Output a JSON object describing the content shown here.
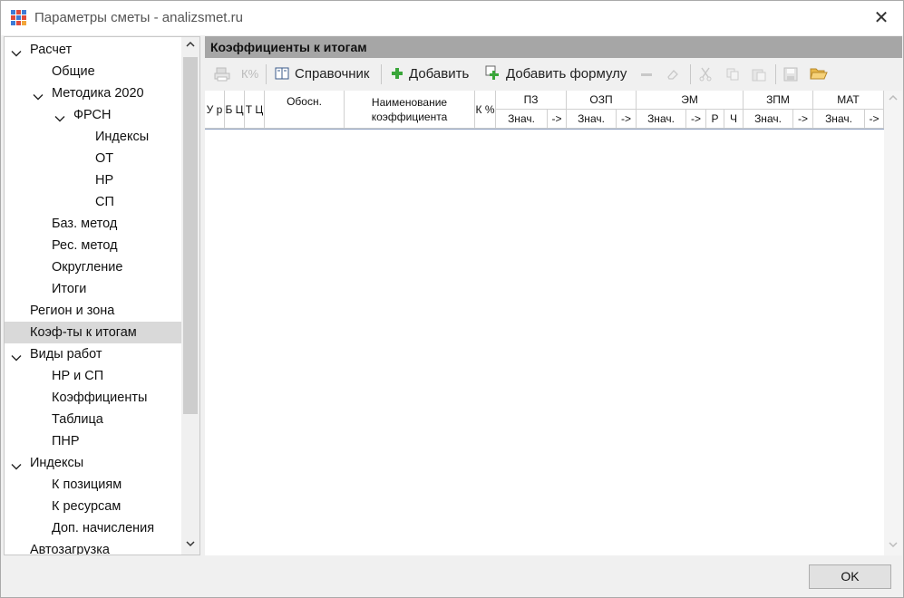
{
  "window": {
    "title": "Параметры сметы - analizsmet.ru",
    "close_icon": "close-icon"
  },
  "tree": {
    "items": [
      {
        "label": "Расчет",
        "level": 0,
        "expanded": true
      },
      {
        "label": "Общие",
        "level": 1
      },
      {
        "label": "Методика 2020",
        "level": 1,
        "expanded": true
      },
      {
        "label": "ФРСН",
        "level": 2,
        "expanded": true
      },
      {
        "label": "Индексы",
        "level": 3
      },
      {
        "label": "ОТ",
        "level": 3
      },
      {
        "label": "НР",
        "level": 3
      },
      {
        "label": "СП",
        "level": 3
      },
      {
        "label": "Баз. метод",
        "level": 1
      },
      {
        "label": "Рес. метод",
        "level": 1
      },
      {
        "label": "Округление",
        "level": 1
      },
      {
        "label": "Итоги",
        "level": 1
      },
      {
        "label": "Регион и зона",
        "level": 0
      },
      {
        "label": "Коэф-ты к итогам",
        "level": 0,
        "selected": true
      },
      {
        "label": "Виды работ",
        "level": 0,
        "expanded": true
      },
      {
        "label": "НР и СП",
        "level": 1
      },
      {
        "label": "Коэффициенты",
        "level": 1
      },
      {
        "label": "Таблица",
        "level": 1
      },
      {
        "label": "ПНР",
        "level": 1
      },
      {
        "label": "Индексы",
        "level": 0,
        "expanded": true
      },
      {
        "label": "К позициям",
        "level": 1
      },
      {
        "label": "К ресурсам",
        "level": 1
      },
      {
        "label": "Доп. начисления",
        "level": 1
      },
      {
        "label": "Автозагрузка",
        "level": 0
      }
    ]
  },
  "panel": {
    "title": "Коэффициенты к итогам",
    "toolbar": {
      "reference_label": "Справочник",
      "add_label": "Добавить",
      "add_formula_label": "Добавить формулу",
      "percent_glyph": "К%"
    },
    "columns": {
      "ur": "У р",
      "bc": "Б Ц",
      "tc": "Т Ц",
      "obosn": "Обосн.",
      "name": "Наименование коэффициента",
      "kpct": "К %",
      "pz": "ПЗ",
      "ozp": "ОЗП",
      "em": "ЭМ",
      "zpm": "ЗПМ",
      "mat": "МАТ",
      "znach": "Знач.",
      "arrow": "->",
      "r": "Р",
      "ch": "Ч"
    }
  },
  "footer": {
    "ok_label": "OK"
  },
  "colors": {
    "header_bar": "#a6a6a6",
    "selection": "#d9d9d9",
    "grid_line": "#8da0c0"
  }
}
